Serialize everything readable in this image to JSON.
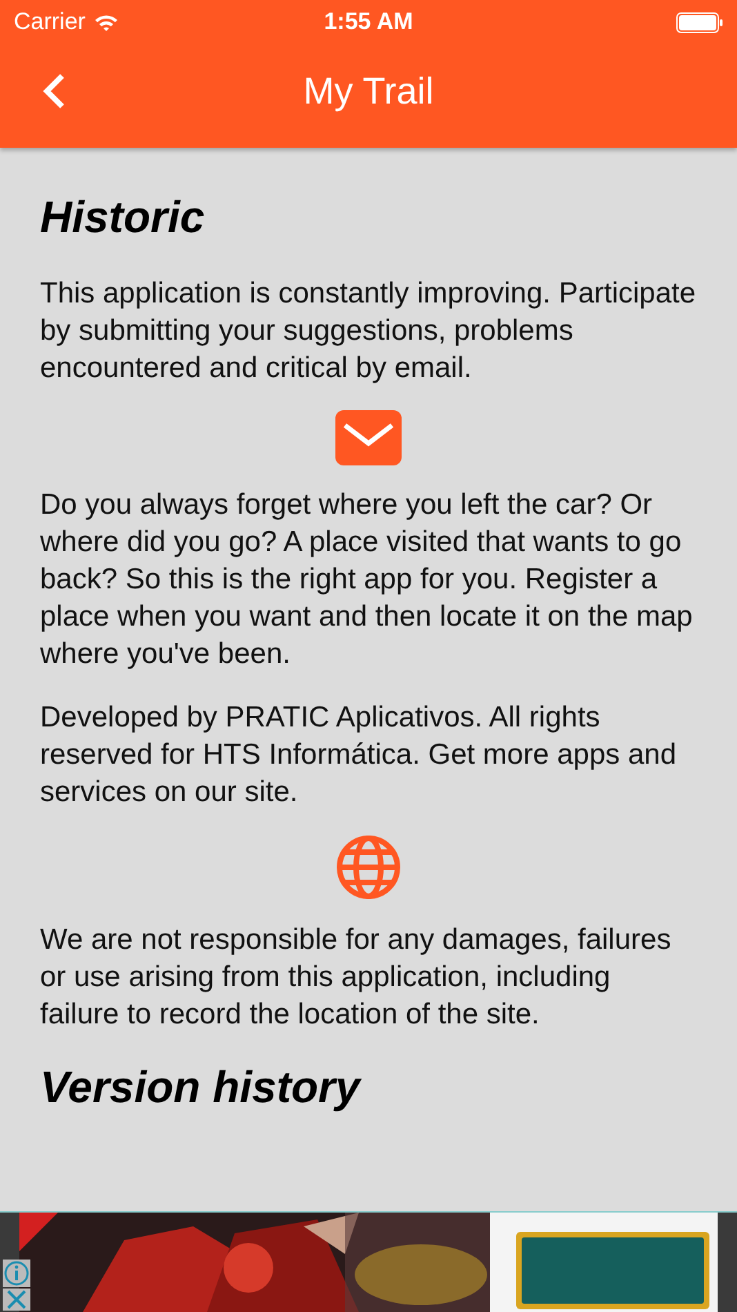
{
  "status_bar": {
    "carrier": "Carrier",
    "time": "1:55 AM"
  },
  "nav_bar": {
    "title": "My Trail"
  },
  "content": [
    {
      "kind": "heading",
      "text": "Historic"
    },
    {
      "kind": "paragraph",
      "text": "This application is constantly improving. Participate by submitting your suggestions, problems encountered and critical by email."
    },
    {
      "kind": "mail"
    },
    {
      "kind": "paragraph",
      "text": "Do you always forget where you left the car? Or where did you go? A place visited that wants to go back? So this is the right app for you. Register a place when you want and then locate it on the map where you've been."
    },
    {
      "kind": "paragraph",
      "text": "Developed by PRATIC Aplicativos. All rights reserved for HTS Informática. Get more apps and services on our site."
    },
    {
      "kind": "globe"
    },
    {
      "kind": "paragraph",
      "text": "We are not responsible for any damages, failures or use arising from this application, including failure to record the location of the site."
    },
    {
      "kind": "heading",
      "text": "Version history"
    }
  ]
}
